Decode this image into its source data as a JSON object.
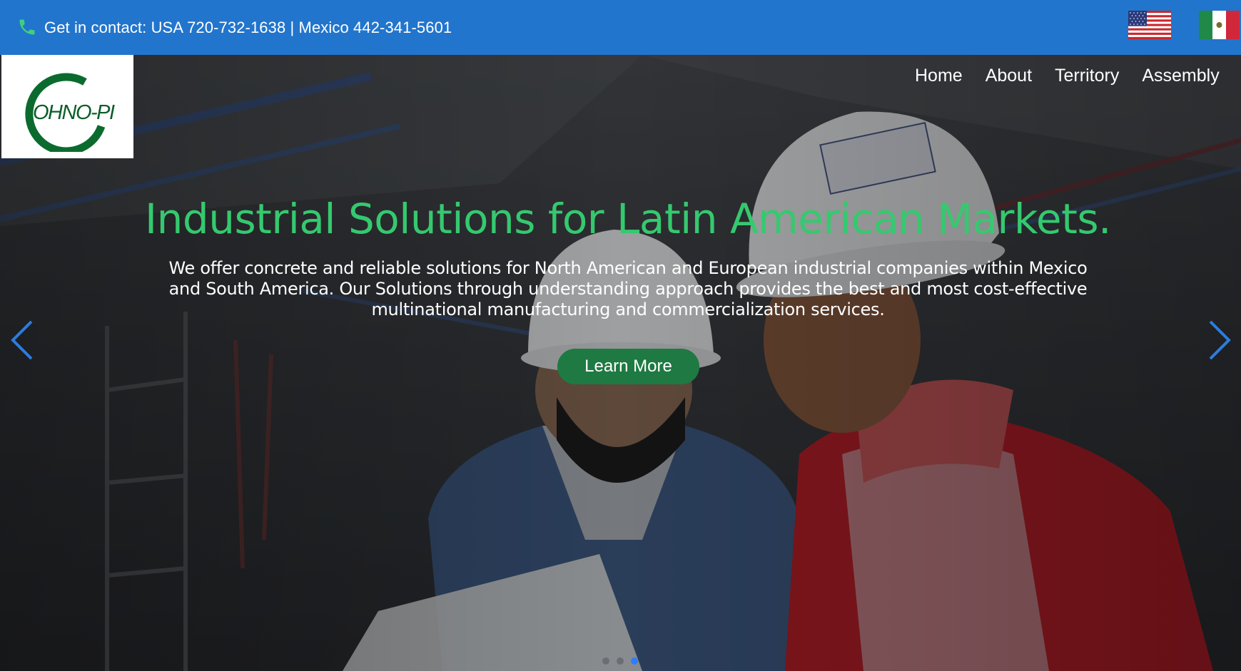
{
  "topbar": {
    "contact_text": "Get in contact: USA 720-732-1638 | Mexico 442-341-5601",
    "phone_icon": "phone-icon",
    "flags": [
      "us-flag-icon",
      "mexico-flag-icon"
    ],
    "background_color": "#2275cc"
  },
  "logo": {
    "text": "OHNO-PI",
    "ring_color": "#0b6b2e"
  },
  "nav": {
    "items": [
      "Home",
      "About",
      "Territory",
      "Assembly"
    ]
  },
  "hero": {
    "title": "Industrial Solutions for Latin American Markets.",
    "description": "We offer concrete and reliable solutions for North American and European industrial companies within Mexico and South America. Our Solutions through understanding approach provides the best and most cost-effective multinational manufacturing and commercialization services.",
    "button_label": "Learn More",
    "title_color": "#35c96f",
    "button_color": "#1e7a42",
    "slide_count": 3,
    "active_slide": 3,
    "prev_icon": "chevron-left-icon",
    "next_icon": "chevron-right-icon"
  }
}
